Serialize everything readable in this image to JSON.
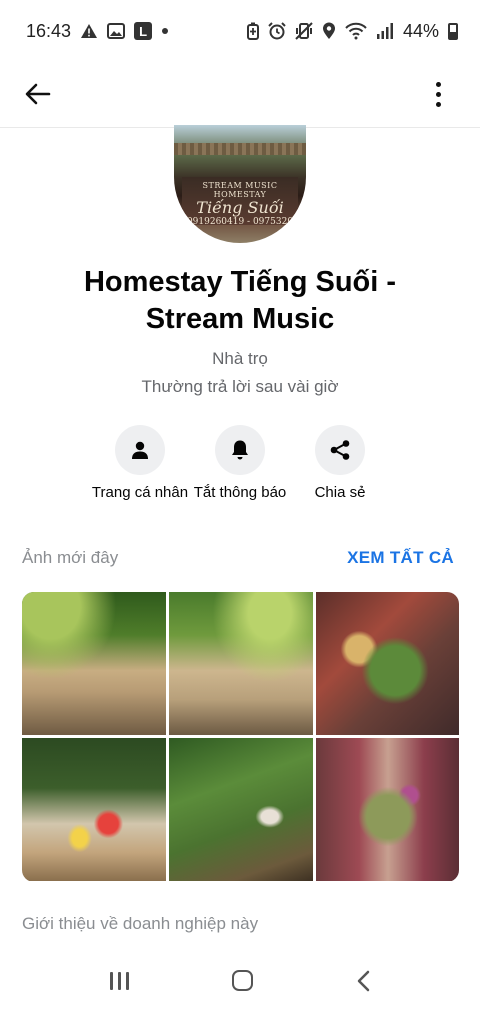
{
  "status_bar": {
    "time": "16:43",
    "left_icons": [
      "warning-icon",
      "image-icon",
      "l-app-icon",
      "dot-icon"
    ],
    "right_icons": [
      "battery-saver-icon",
      "alarm-icon",
      "vibrate-icon",
      "location-icon",
      "wifi-icon",
      "signal-icon"
    ],
    "battery": "44%"
  },
  "app_bar": {
    "back_icon": "arrow-left-icon",
    "more_icon": "more-vertical-icon"
  },
  "profile": {
    "avatar_sign_top": "STREAM MUSIC HOMESTAY",
    "avatar_sign_main": "Tiếng Suối",
    "avatar_sign_phone": "0919260419 - 0975320",
    "name_line1": "Homestay Tiếng Suối -",
    "name_line2": "Stream Music",
    "category": "Nhà trọ",
    "response_time": "Thường trả lời sau vài giờ"
  },
  "actions": [
    {
      "label": "Trang cá nhân",
      "icon": "person-icon"
    },
    {
      "label": "Tắt thông báo",
      "icon": "bell-icon"
    },
    {
      "label": "Chia sẻ",
      "icon": "share-icon"
    }
  ],
  "recent_photos": {
    "label": "Ảnh mới đây",
    "see_all": "XEM TẤT CẢ"
  },
  "intro_label": "Giới thiệu về doanh nghiệp này",
  "nav_bar": {
    "icons": [
      "recent-apps-icon",
      "home-icon",
      "back-nav-icon"
    ]
  },
  "colors": {
    "accent": "#1b74e4",
    "secondary_text": "#65676b",
    "action_bg": "#eeeff1"
  }
}
